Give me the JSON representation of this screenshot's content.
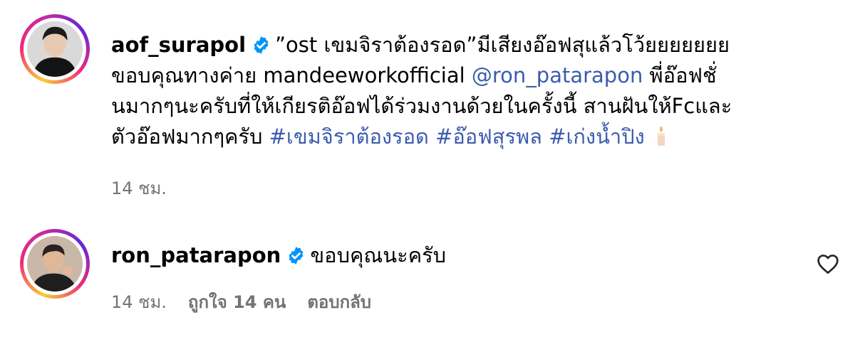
{
  "comments": [
    {
      "username": "aof_surapol",
      "text_line1": "”ost เขมจิราต้องรอด”มีเสียงอ๊อฟสุแล้วโว้ยยยยยยย",
      "text_line2_prefix": "ขอบคุณทางค่าย mandeeworkofficial ",
      "mention": "@ron_patarapon",
      "text_line2_suffix": " พี่อ๊อฟชั่",
      "text_line3": "นมากๆนะครับที่ให้เกียรติอ๊อฟได้ร่วมงานด้วยในครั้งนี้ สานฝันให้Fcและ",
      "text_line4_prefix": "ตัวอ๊อฟมากๆครับ ",
      "hashtags": [
        "#เขมจิราต้องรอด",
        "#อ๊อฟสุรพล",
        "#เก่งน้ำปิง"
      ],
      "emoji": "candle-emoji",
      "time": "14 ชม."
    },
    {
      "username": "ron_patarapon",
      "text": "ขอบคุณนะครับ",
      "time": "14 ชม.",
      "likes": "ถูกใจ 14 คน",
      "reply_label": "ตอบกลับ",
      "like_icon": "heart-icon"
    }
  ],
  "colors": {
    "link": "#3b5cad",
    "meta": "#737373",
    "verified": "#0095f6"
  }
}
